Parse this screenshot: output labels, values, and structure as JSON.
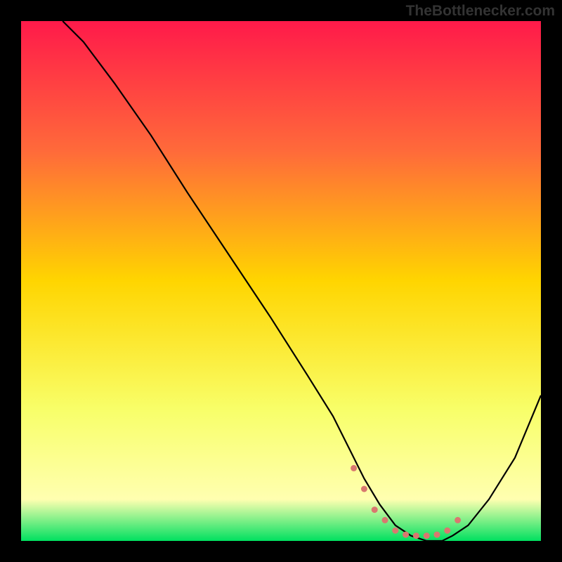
{
  "watermark": "TheBottlenecker.com",
  "chart_data": {
    "type": "line",
    "title": "",
    "xlabel": "",
    "ylabel": "",
    "xlim": [
      0,
      100
    ],
    "ylim": [
      0,
      100
    ],
    "gradient_stops": [
      {
        "offset": 0,
        "color": "#ff1a4a"
      },
      {
        "offset": 25,
        "color": "#ff6a3a"
      },
      {
        "offset": 50,
        "color": "#ffd500"
      },
      {
        "offset": 75,
        "color": "#f8ff6a"
      },
      {
        "offset": 92,
        "color": "#ffffb0"
      },
      {
        "offset": 100,
        "color": "#00e060"
      }
    ],
    "series": [
      {
        "name": "curve",
        "x": [
          8,
          12,
          18,
          25,
          32,
          40,
          48,
          55,
          60,
          63,
          66,
          69,
          72,
          75,
          78,
          81,
          83,
          86,
          90,
          95,
          100
        ],
        "y": [
          100,
          96,
          88,
          78,
          67,
          55,
          43,
          32,
          24,
          18,
          12,
          7,
          3,
          1,
          0,
          0,
          1,
          3,
          8,
          16,
          28
        ]
      }
    ],
    "markers": {
      "name": "bottom-dots",
      "color": "#d9786f",
      "x": [
        64,
        66,
        68,
        70,
        72,
        74,
        76,
        78,
        80,
        82,
        84
      ],
      "y": [
        14,
        10,
        6,
        4,
        2,
        1.2,
        1,
        1,
        1.2,
        2,
        4
      ]
    }
  }
}
